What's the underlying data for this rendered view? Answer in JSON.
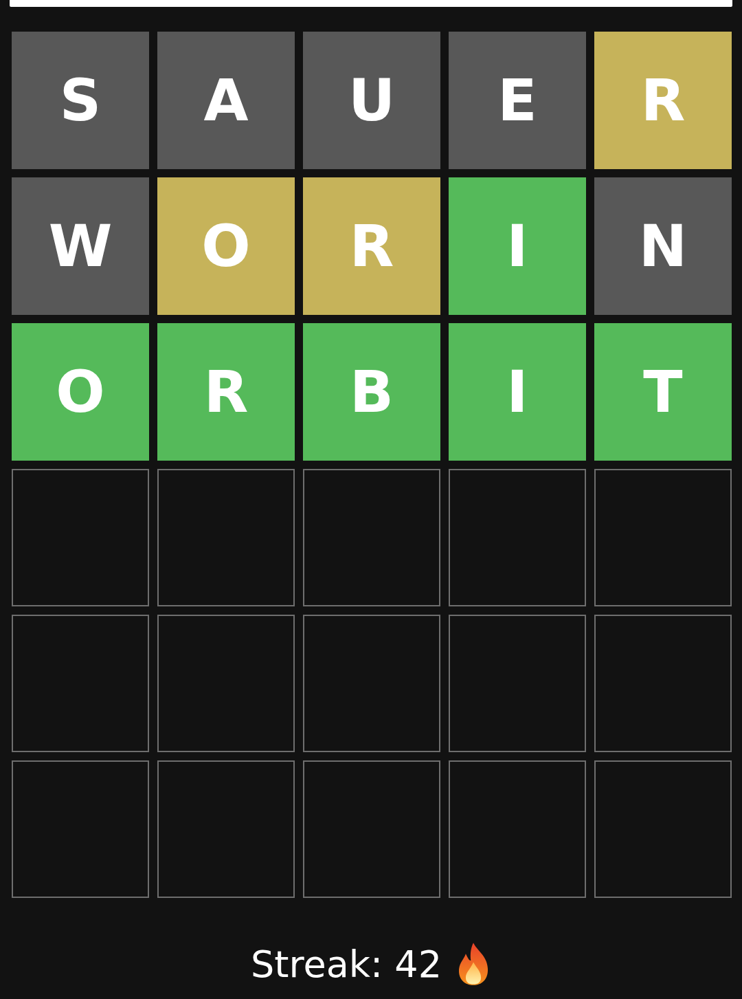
{
  "guess_input": {
    "kind": "field"
  },
  "board": [
    [
      {
        "letter": "S",
        "kind": "absent"
      },
      {
        "letter": "A",
        "kind": "absent"
      },
      {
        "letter": "U",
        "kind": "absent"
      },
      {
        "letter": "E",
        "kind": "absent"
      },
      {
        "letter": "R",
        "kind": "present"
      }
    ],
    [
      {
        "letter": "W",
        "kind": "absent"
      },
      {
        "letter": "O",
        "kind": "present"
      },
      {
        "letter": "R",
        "kind": "present"
      },
      {
        "letter": "I",
        "kind": "correct"
      },
      {
        "letter": "N",
        "kind": "absent"
      }
    ],
    [
      {
        "letter": "O",
        "kind": "correct"
      },
      {
        "letter": "R",
        "kind": "correct"
      },
      {
        "letter": "B",
        "kind": "correct"
      },
      {
        "letter": "I",
        "kind": "correct"
      },
      {
        "letter": "T",
        "kind": "correct"
      }
    ],
    [
      {
        "kind": "empty"
      },
      {
        "kind": "empty"
      },
      {
        "kind": "empty"
      },
      {
        "kind": "empty"
      },
      {
        "kind": "empty"
      }
    ],
    [
      {
        "kind": "empty"
      },
      {
        "kind": "empty"
      },
      {
        "kind": "empty"
      },
      {
        "kind": "empty"
      },
      {
        "kind": "empty"
      }
    ],
    [
      {
        "kind": "empty"
      },
      {
        "kind": "empty"
      },
      {
        "kind": "empty"
      },
      {
        "kind": "empty"
      },
      {
        "kind": "empty"
      }
    ]
  ],
  "streak": {
    "label": "Streak: 42"
  }
}
